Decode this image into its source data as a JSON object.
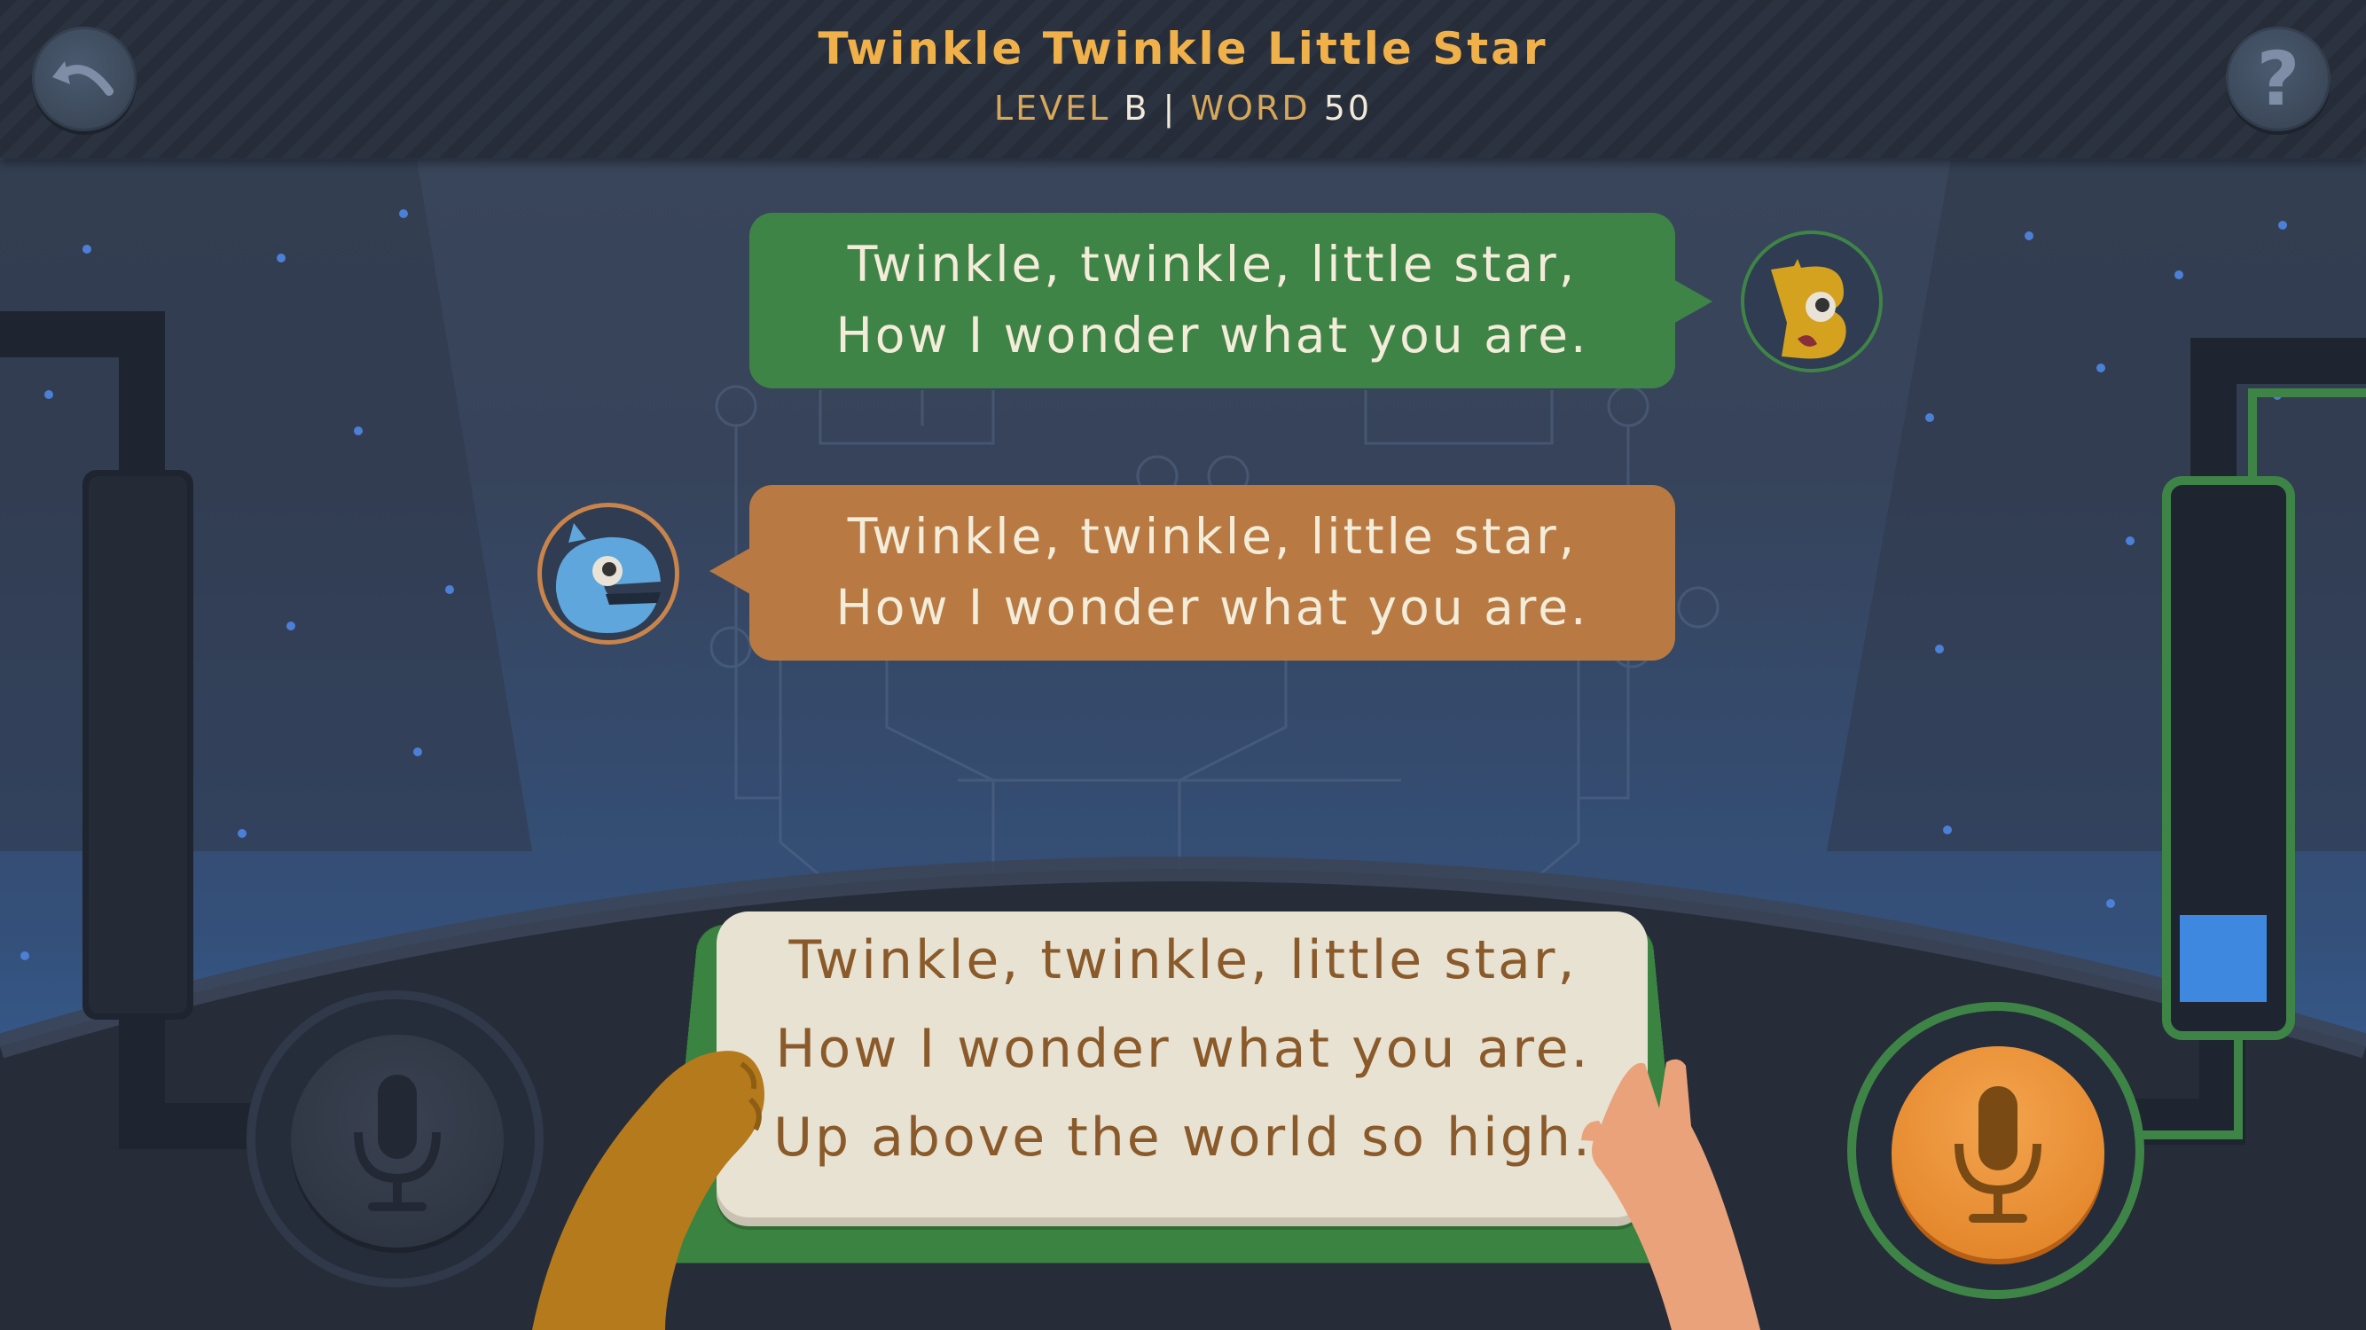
{
  "header": {
    "title": "Twinkle Twinkle Little Star",
    "level_label": "LEVEL",
    "level_value": "B",
    "separator": "|",
    "word_label": "WORD",
    "word_value": "50"
  },
  "buttons": {
    "back_icon": "back-arrow-icon",
    "help_label": "?"
  },
  "dialogue": [
    {
      "speaker": "B",
      "color": "#3f8447",
      "lines": [
        "Twinkle, twinkle, little star,",
        "How I wonder what you are."
      ]
    },
    {
      "speaker": "e",
      "color": "#b87a42",
      "lines": [
        "Twinkle, twinkle, little star,",
        "How I wonder what you are."
      ]
    }
  ],
  "book": {
    "lines": [
      "Twinkle, twinkle, little star,",
      "How I wonder what you are.",
      "Up above the world so high."
    ]
  },
  "mics": {
    "left": {
      "state": "inactive",
      "icon": "microphone-icon"
    },
    "right": {
      "state": "active",
      "icon": "microphone-icon"
    }
  },
  "colors": {
    "title": "#f0b14a",
    "player_b": "#3f8447",
    "player_e": "#b87a42",
    "mic_active": "#e88a2a",
    "level_indicator": "#3f88e0"
  }
}
